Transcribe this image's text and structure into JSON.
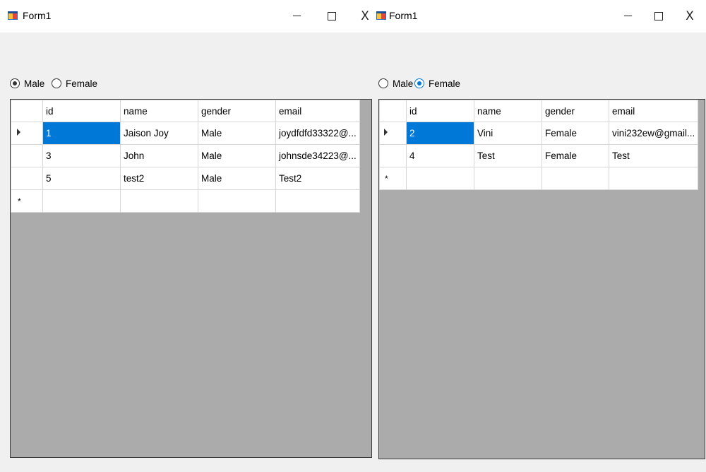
{
  "windows": [
    {
      "title": "Form1",
      "controls": {
        "minimize": "–",
        "maximize": "□",
        "close": "X"
      },
      "radios": [
        {
          "label": "Male",
          "checked": true
        },
        {
          "label": "Female",
          "checked": false
        }
      ],
      "grid": {
        "columns": [
          "id",
          "name",
          "gender",
          "email"
        ],
        "rows": [
          {
            "id": "1",
            "name": "Jaison Joy",
            "gender": "Male",
            "email": "joydfdfd33322@..."
          },
          {
            "id": "3",
            "name": "John",
            "gender": "Male",
            "email": "johnsde34223@..."
          },
          {
            "id": "5",
            "name": "test2",
            "gender": "Male",
            "email": "Test2"
          }
        ],
        "new_row_marker": "*"
      }
    },
    {
      "title": "Form1",
      "controls": {
        "minimize": "–",
        "maximize": "□",
        "close": "X"
      },
      "radios": [
        {
          "label": "Male",
          "checked": false
        },
        {
          "label": "Female",
          "checked": true
        }
      ],
      "grid": {
        "columns": [
          "id",
          "name",
          "gender",
          "email"
        ],
        "rows": [
          {
            "id": "2",
            "name": "Vini",
            "gender": "Female",
            "email": "vini232ew@gmail..."
          },
          {
            "id": "4",
            "name": "Test",
            "gender": "Female",
            "email": "Test"
          }
        ],
        "new_row_marker": "*"
      }
    }
  ],
  "colors": {
    "selection": "#0078d7",
    "grid_background": "#ababab",
    "form_background": "#f0f0f0"
  }
}
